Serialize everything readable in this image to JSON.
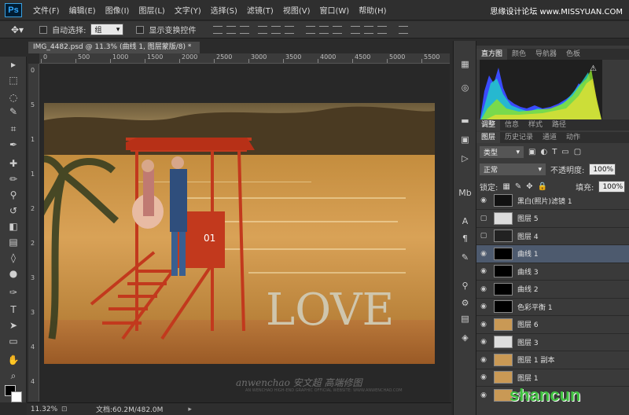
{
  "app": {
    "name": "Ps"
  },
  "menu": [
    "文件(F)",
    "编辑(E)",
    "图像(I)",
    "图层(L)",
    "文字(Y)",
    "选择(S)",
    "滤镜(T)",
    "视图(V)",
    "窗口(W)",
    "帮助(H)"
  ],
  "top_watermark": "思缘设计论坛 www.MISSYUAN.COM",
  "options": {
    "auto_select": "自动选择:",
    "auto_select_value": "组",
    "show_transform": "显示变换控件"
  },
  "document": {
    "tab": "IMG_4482.psd @ 11.3% (曲线 1, 图层蒙版/8) *",
    "zoom": "11.32%",
    "doc_size": "文档:60.2M/482.0M"
  },
  "ruler_h": [
    "0",
    "500",
    "1000",
    "1500",
    "2000",
    "2500",
    "3000",
    "3500",
    "4000",
    "4500",
    "5000",
    "5500"
  ],
  "ruler_v": [
    "0",
    "5",
    "1",
    "1",
    "2",
    "2",
    "3",
    "3",
    "4",
    "4"
  ],
  "photo": {
    "sign": "01",
    "letters": "LOVE"
  },
  "photo_watermark": "anwenchao 安文超 高端修图",
  "photo_watermark_sub": "AN WENCHAO HIGH-END GRAPHIC OFFICIAL WEBSITE: WWW.ANWENCHAO.COM",
  "panels": {
    "top_tabs": [
      "直方图",
      "颜色",
      "导航器",
      "色板"
    ],
    "adj_tabs": [
      "调整",
      "信息",
      "样式",
      "路径"
    ],
    "layer_tabs": [
      "图层",
      "历史记录",
      "通道",
      "动作"
    ],
    "kind": "类型",
    "blend": "正常",
    "opacity_label": "不透明度:",
    "opacity": "100%",
    "lock_label": "锁定:",
    "fill_label": "填充:",
    "fill": "100%"
  },
  "layers": [
    {
      "name": "黑白(照片)滤镜 1",
      "thumb": "#111111",
      "visible": true
    },
    {
      "name": "图层 5",
      "thumb": "#dddddd",
      "visible": false
    },
    {
      "name": "图层 4",
      "thumb": "#222222",
      "visible": false
    },
    {
      "name": "曲线 1",
      "thumb": "#000000",
      "visible": true,
      "selected": true
    },
    {
      "name": "曲线 3",
      "thumb": "#000000",
      "visible": true
    },
    {
      "name": "曲线 2",
      "thumb": "#000000",
      "visible": true
    },
    {
      "name": "色彩平衡 1",
      "thumb": "#000000",
      "visible": true
    },
    {
      "name": "图层 6",
      "thumb": "#c99955",
      "visible": true
    },
    {
      "name": "图层 3",
      "thumb": "#dddddd",
      "visible": true
    },
    {
      "name": "图层 1 副本",
      "thumb": "#c99955",
      "visible": true
    },
    {
      "name": "图层 1",
      "thumb": "#c99955",
      "visible": true
    },
    {
      "name": "背景",
      "thumb": "#c99955",
      "visible": true
    }
  ],
  "corner_watermark": "shancun"
}
